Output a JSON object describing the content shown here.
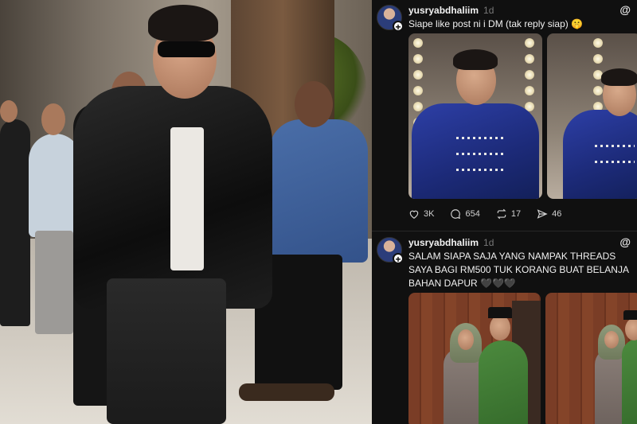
{
  "posts": [
    {
      "username": "yusryabdhaliim",
      "time": "1d",
      "caption": "Siape like post ni i DM (tak reply siap) 🤫",
      "stats": {
        "likes": "3K",
        "comments": "654",
        "reposts": "17",
        "shares": "46"
      }
    },
    {
      "username": "yusryabdhaliim",
      "time": "1d",
      "caption": "SALAM SIAPA SAJA YANG NAMPAK THREADS  SAYA BAGI RM500 TUK KORANG BUAT BELANJA BAHAN DAPUR 🖤🖤🖤"
    }
  ],
  "colors": {
    "background": "#101010",
    "text": "#f3f3f3",
    "muted": "#777777"
  }
}
